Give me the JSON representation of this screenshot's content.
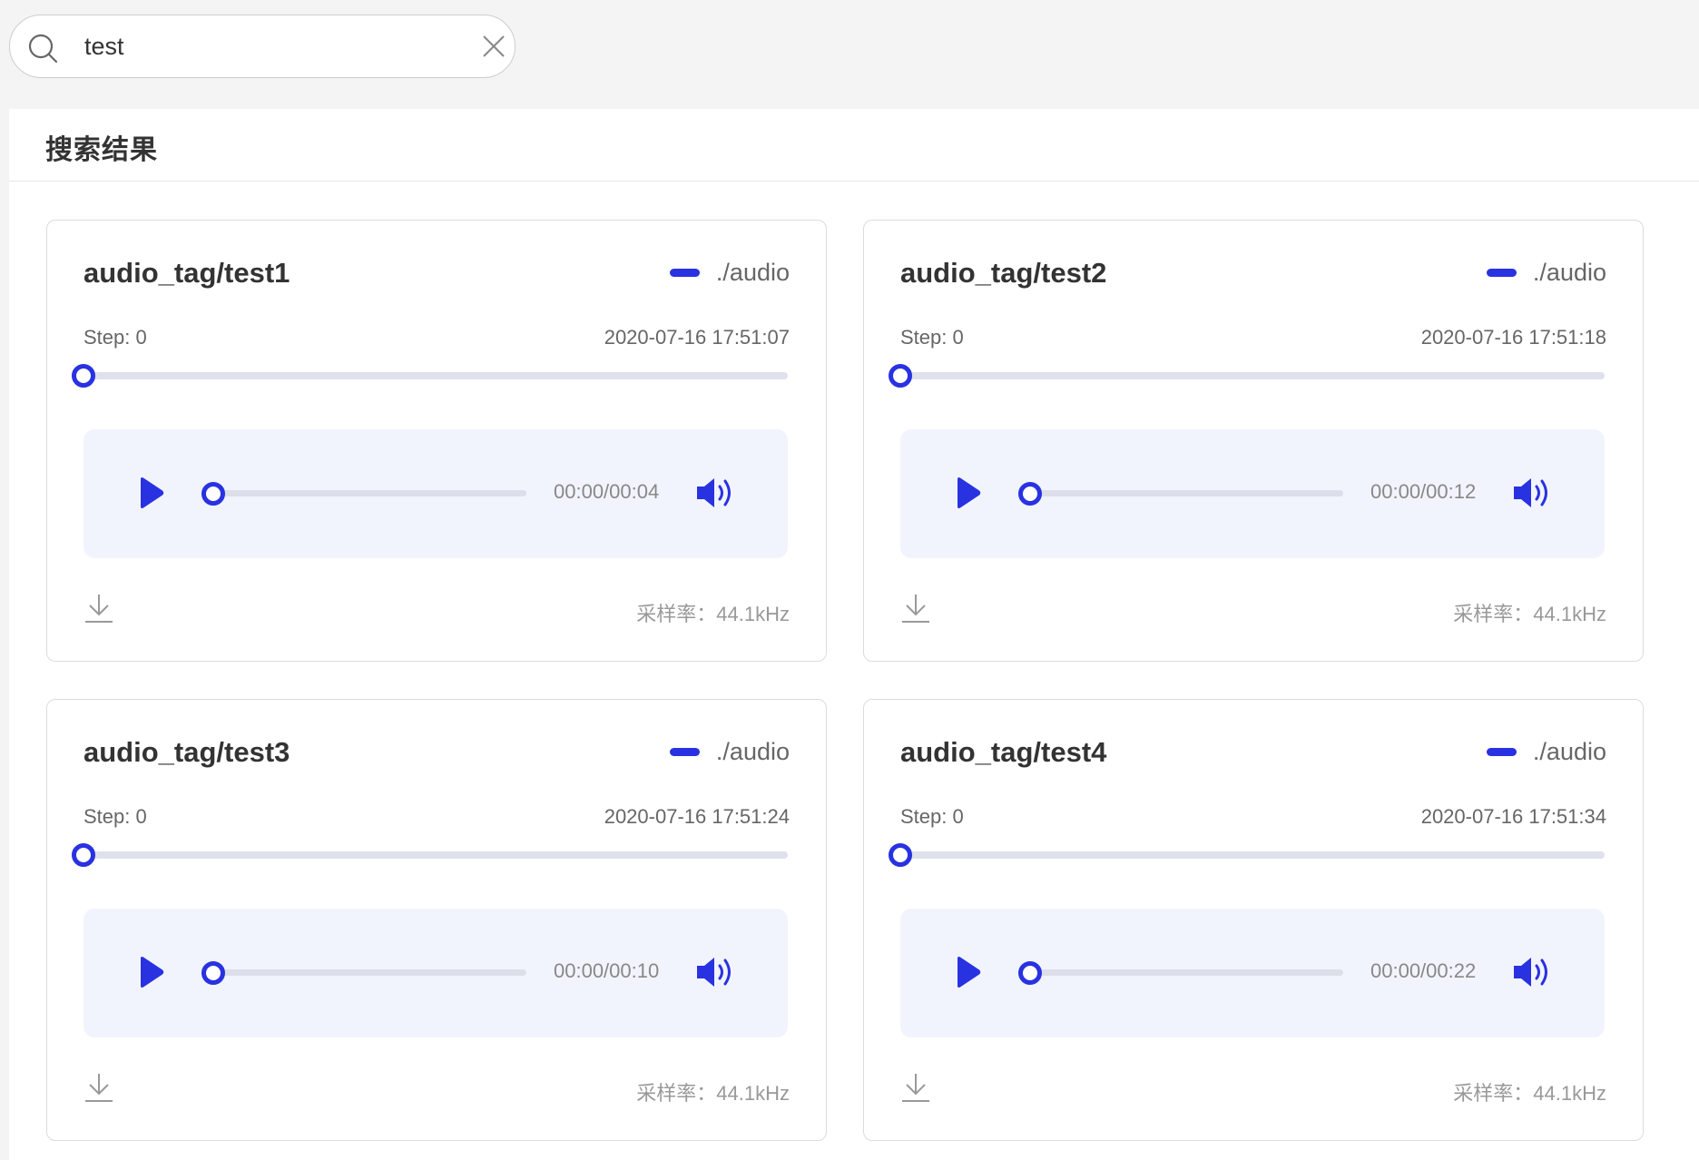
{
  "search": {
    "value": "test",
    "placeholder": ""
  },
  "panel": {
    "title": "搜索结果"
  },
  "cards": [
    {
      "tag": "audio_tag/test1",
      "run": "./audio",
      "step_label": "Step: 0",
      "time": "2020-07-16 17:51:07",
      "step_progress": 0,
      "audio_time": "00:00/00:04",
      "audio_progress": 0,
      "sample_rate": "采样率：44.1kHz"
    },
    {
      "tag": "audio_tag/test2",
      "run": "./audio",
      "step_label": "Step: 0",
      "time": "2020-07-16 17:51:18",
      "step_progress": 0,
      "audio_time": "00:00/00:12",
      "audio_progress": 0,
      "sample_rate": "采样率：44.1kHz"
    },
    {
      "tag": "audio_tag/test3",
      "run": "./audio",
      "step_label": "Step: 0",
      "time": "2020-07-16 17:51:24",
      "step_progress": 0,
      "audio_time": "00:00/00:10",
      "audio_progress": 0,
      "sample_rate": "采样率：44.1kHz"
    },
    {
      "tag": "audio_tag/test4",
      "run": "./audio",
      "step_label": "Step: 0",
      "time": "2020-07-16 17:51:34",
      "step_progress": 0,
      "audio_time": "00:00/00:22",
      "audio_progress": 0,
      "sample_rate": "采样率：44.1kHz"
    }
  ],
  "colors": {
    "accent": "#2932e1",
    "player_bg": "#f2f4fd",
    "track": "#dfe1ec"
  },
  "icons": {
    "search": "search-icon",
    "clear": "close-icon",
    "play": "play-icon",
    "volume": "volume-icon",
    "download": "download-icon"
  }
}
